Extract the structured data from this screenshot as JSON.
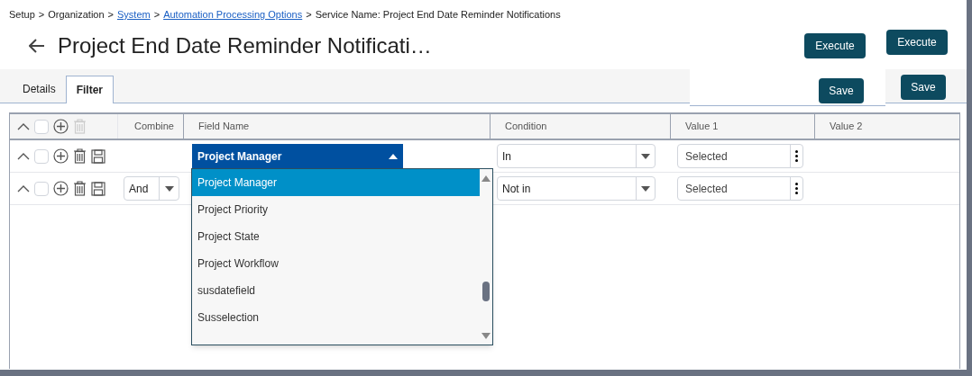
{
  "breadcrumb": {
    "separator": ">",
    "items": [
      {
        "text": "Setup",
        "link": false
      },
      {
        "text": "Organization",
        "link": false
      },
      {
        "text": "System",
        "link": true
      },
      {
        "text": "Automation Processing Options",
        "link": true
      },
      {
        "text": "Service Name: Project End Date Reminder Notifications",
        "link": false
      }
    ]
  },
  "title": "Project End Date Reminder Notificati…",
  "execute_buttons": [
    "Execute",
    "Execute"
  ],
  "save_buttons": [
    "Save",
    "Save"
  ],
  "tabs": [
    {
      "label": "Details",
      "selected": false
    },
    {
      "label": "Filter",
      "selected": true
    }
  ],
  "table": {
    "header": {
      "checked": false,
      "delete_disabled": true
    },
    "columns": [
      "Combine",
      "Field Name",
      "Condition",
      "Value 1",
      "Value 2"
    ],
    "rows": [
      {
        "checked": false,
        "combine": null,
        "field": "Project Manager",
        "open": true,
        "condition": "In",
        "value_1": "Selected"
      },
      {
        "checked": false,
        "combine": "And",
        "field": null,
        "condition": "Not in",
        "value_1": "Selected"
      }
    ]
  },
  "dropdown": {
    "options": [
      {
        "label": "Project Manager",
        "selected": true
      },
      {
        "label": "Project Priority",
        "selected": false
      },
      {
        "label": "Project State",
        "selected": false
      },
      {
        "label": "Project Workflow",
        "selected": false
      },
      {
        "label": "susdatefield",
        "selected": false
      },
      {
        "label": "Susselection",
        "selected": false
      }
    ]
  }
}
